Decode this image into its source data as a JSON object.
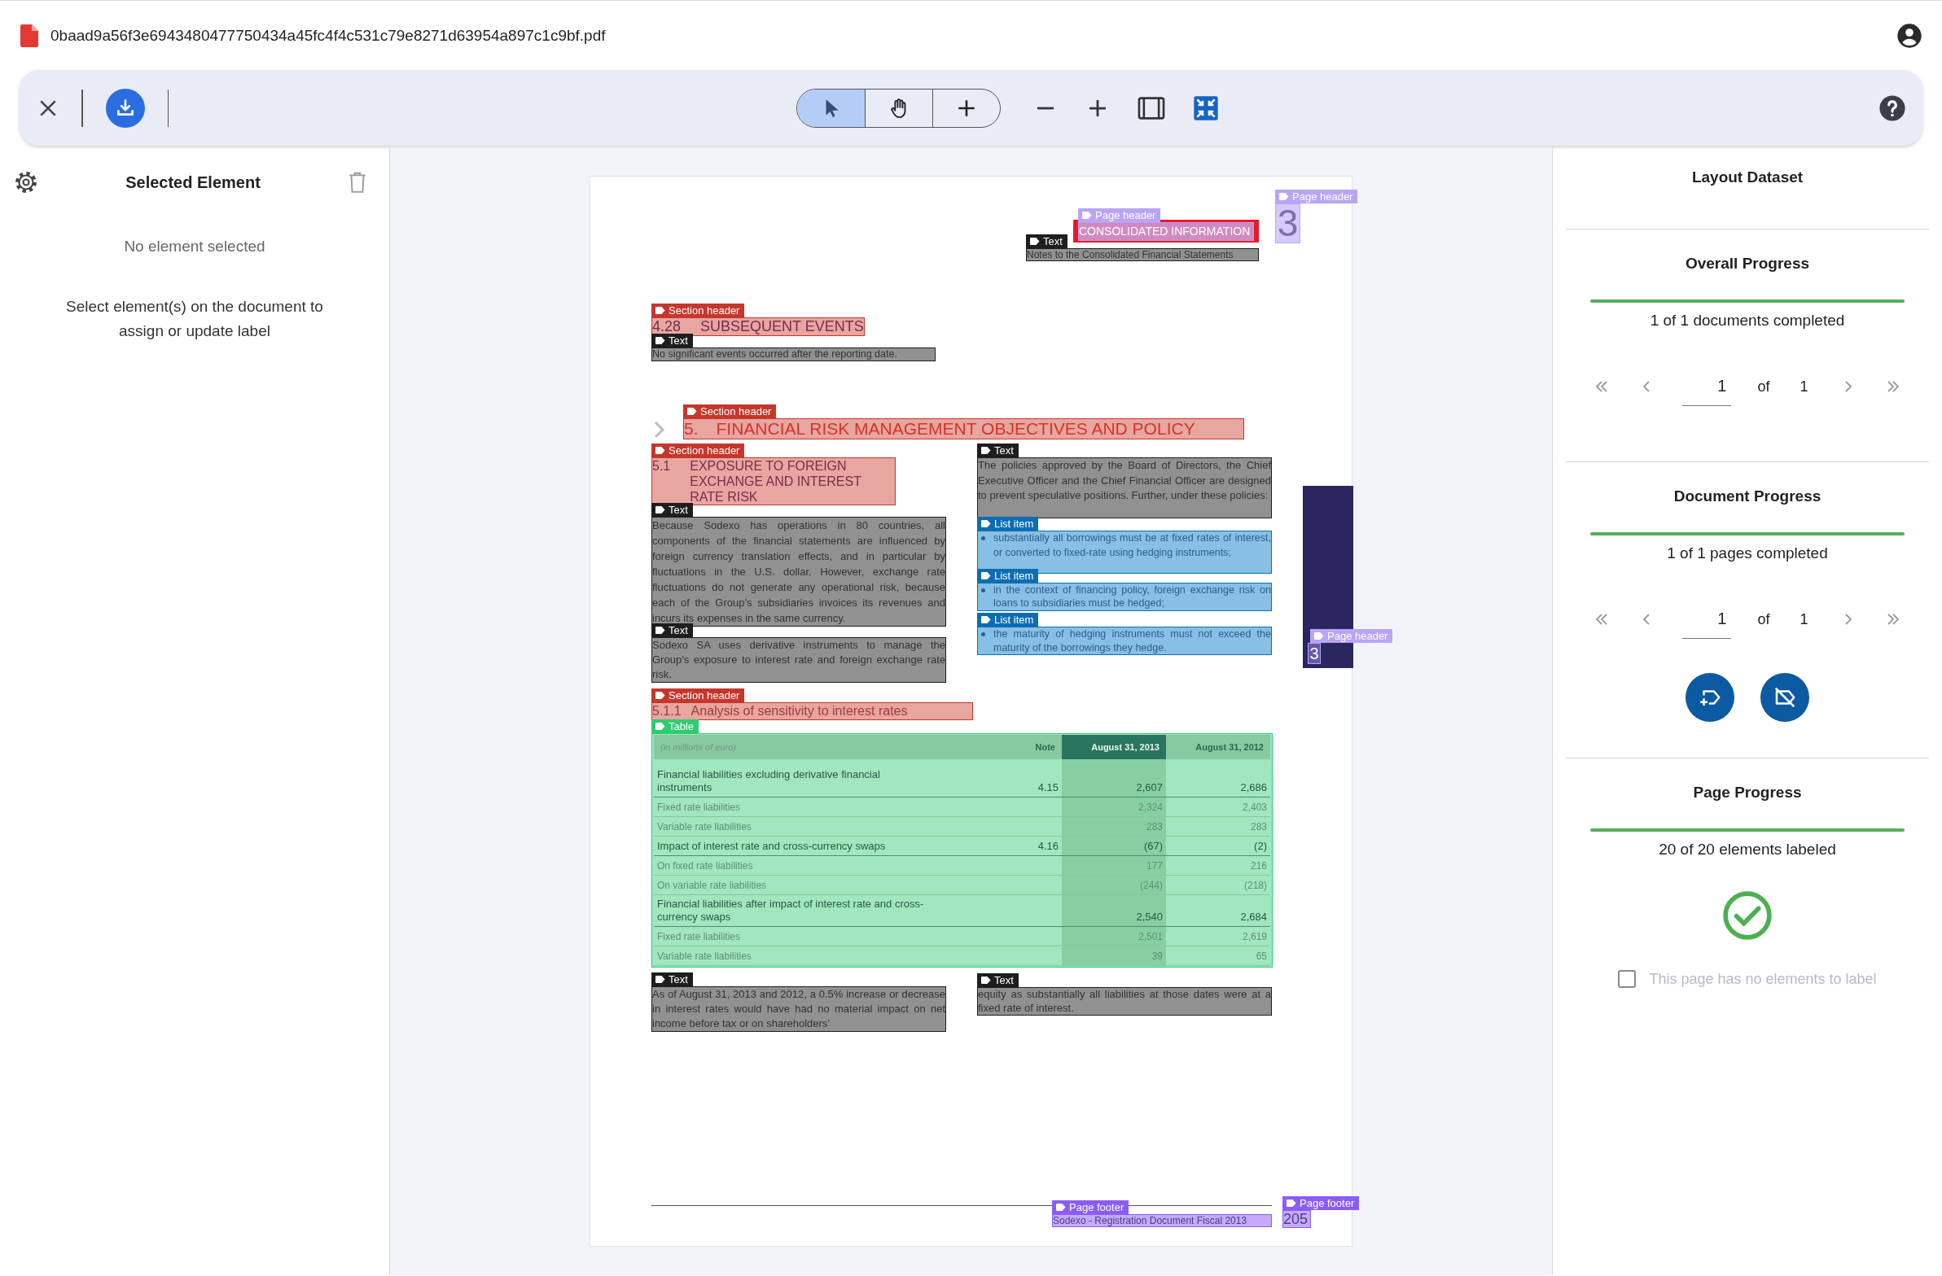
{
  "file": {
    "name": "0baad9a56f3e6943480477750434a45fc4f4c531c79e8271d63954a897c1c9bf.pdf"
  },
  "toolbar": {
    "tools": [
      {
        "kind": "select",
        "selected": true
      },
      {
        "kind": "pan",
        "selected": false
      },
      {
        "kind": "add",
        "selected": false
      }
    ]
  },
  "selection_panel": {
    "title": "Selected Element",
    "empty_message": "No element selected",
    "hint": "Select element(s) on the document to assign or update label"
  },
  "document": {
    "elements": [
      {
        "kind": "page_header",
        "label": "Page header",
        "text": "CONSOLIDATED INFORMATION"
      },
      {
        "kind": "page_header",
        "label": "Page header",
        "text": "3"
      },
      {
        "kind": "text",
        "label": "Text",
        "text": "Notes to the Consolidated Financial Statements"
      },
      {
        "kind": "section_header",
        "label": "Section header",
        "number": "4.28",
        "text": "SUBSEQUENT EVENTS"
      },
      {
        "kind": "text",
        "label": "Text",
        "text": "No significant events occurred after the reporting date."
      },
      {
        "kind": "section_header",
        "label": "Section header",
        "number": "5.",
        "text": "FINANCIAL RISK MANAGEMENT OBJECTIVES AND POLICY"
      },
      {
        "kind": "section_header",
        "label": "Section header",
        "number": "5.1",
        "text": "EXPOSURE TO FOREIGN EXCHANGE AND INTEREST RATE RISK"
      },
      {
        "kind": "text",
        "label": "Text",
        "text": "Because Sodexo has operations in 80 countries, all components of the financial statements are influenced by foreign currency translation effects, and in particular by fluctuations in the U.S. dollar. However, exchange rate fluctuations do not generate any operational risk, because each of the Group’s subsidiaries invoices its revenues and incurs its expenses in the same currency."
      },
      {
        "kind": "text",
        "label": "Text",
        "text": "Sodexo SA uses derivative instruments to manage the Group’s exposure to interest rate and foreign exchange rate risk."
      },
      {
        "kind": "section_header",
        "label": "Section header",
        "number": "5.1.1",
        "text": "Analysis of sensitivity to interest rates"
      },
      {
        "kind": "table",
        "label": "Table",
        "columns": [
          {
            "text": "(in millions of euro)",
            "highlight": false
          },
          {
            "text": "Note",
            "highlight": false
          },
          {
            "text": "August 31, 2013",
            "highlight": true
          },
          {
            "text": "August 31, 2012",
            "highlight": false
          }
        ],
        "rows": [
          {
            "kind": "total",
            "label": "Financial liabilities excluding derivative financial instruments",
            "note": "4.15",
            "values": [
              "2,607",
              "2,686"
            ]
          },
          {
            "kind": "detail",
            "label": "Fixed rate liabilities",
            "values": [
              "2,324",
              "2,403"
            ]
          },
          {
            "kind": "detail",
            "label": "Variable rate liabilities",
            "values": [
              "283",
              "283"
            ]
          },
          {
            "kind": "total",
            "label": "Impact of interest rate and cross-currency swaps",
            "note": "4.16",
            "values": [
              "(67)",
              "(2)"
            ]
          },
          {
            "kind": "detail",
            "label": "On fixed rate liabilities",
            "values": [
              "177",
              "216"
            ]
          },
          {
            "kind": "detail",
            "label": "On variable rate liabilities",
            "values": [
              "(244)",
              "(218)"
            ]
          },
          {
            "kind": "total",
            "label": "Financial liabilities after impact of interest rate and cross-currency swaps",
            "values": [
              "2,540",
              "2,684"
            ]
          },
          {
            "kind": "detail",
            "label": "Fixed rate liabilities",
            "values": [
              "2,501",
              "2,619"
            ]
          },
          {
            "kind": "detail",
            "label": "Variable rate liabilities",
            "values": [
              "39",
              "65"
            ]
          }
        ]
      },
      {
        "kind": "text",
        "label": "Text",
        "text": "As of August 31, 2013 and 2012, a 0.5% increase or decrease in interest rates would have had no material impact on net income before tax or on shareholders’"
      },
      {
        "kind": "text",
        "label": "Text",
        "text": "The policies approved by the Board of Directors, the Chief Executive Officer and the Chief Financial Officer are designed to prevent speculative positions. Further, under these policies:"
      },
      {
        "kind": "list_item",
        "label": "List item",
        "text": "substantially all borrowings must be at fixed rates of interest, or converted to fixed-rate using hedging instruments;"
      },
      {
        "kind": "list_item",
        "label": "List item",
        "text": "in the context of financing policy, foreign exchange risk on loans to subsidiaries must be hedged;"
      },
      {
        "kind": "list_item",
        "label": "List item",
        "text": "the maturity of hedging instruments must not exceed the maturity of the borrowings they hedge."
      },
      {
        "kind": "text",
        "label": "Text",
        "text": "equity as substantially all liabilities at those dates were at a fixed rate of interest."
      },
      {
        "kind": "page_header",
        "label": "Page header",
        "text": "3"
      },
      {
        "kind": "page_footer",
        "label": "Page footer",
        "text": "Sodexo - Registration Document Fiscal 2013"
      },
      {
        "kind": "page_footer",
        "label": "Page footer",
        "text": "205"
      }
    ]
  },
  "dataset_panel": {
    "title": "Layout Dataset",
    "sections": [
      {
        "title": "Overall Progress",
        "level": 1,
        "summary": "1 of 1 documents completed",
        "pager": {
          "value": "1",
          "of": "of",
          "total": "1"
        }
      },
      {
        "title": "Document Progress",
        "level": 1,
        "summary": "1 of 1 pages completed",
        "pager": {
          "value": "1",
          "of": "of",
          "total": "1"
        },
        "actions": [
          {
            "kind": "add_label"
          },
          {
            "kind": "clear_labels"
          }
        ]
      },
      {
        "title": "Page Progress",
        "level": 1,
        "summary": "20 of 20 elements labeled",
        "complete": true,
        "option": {
          "label": "This page has no elements to label",
          "checked": false,
          "disabled": true
        }
      }
    ]
  }
}
